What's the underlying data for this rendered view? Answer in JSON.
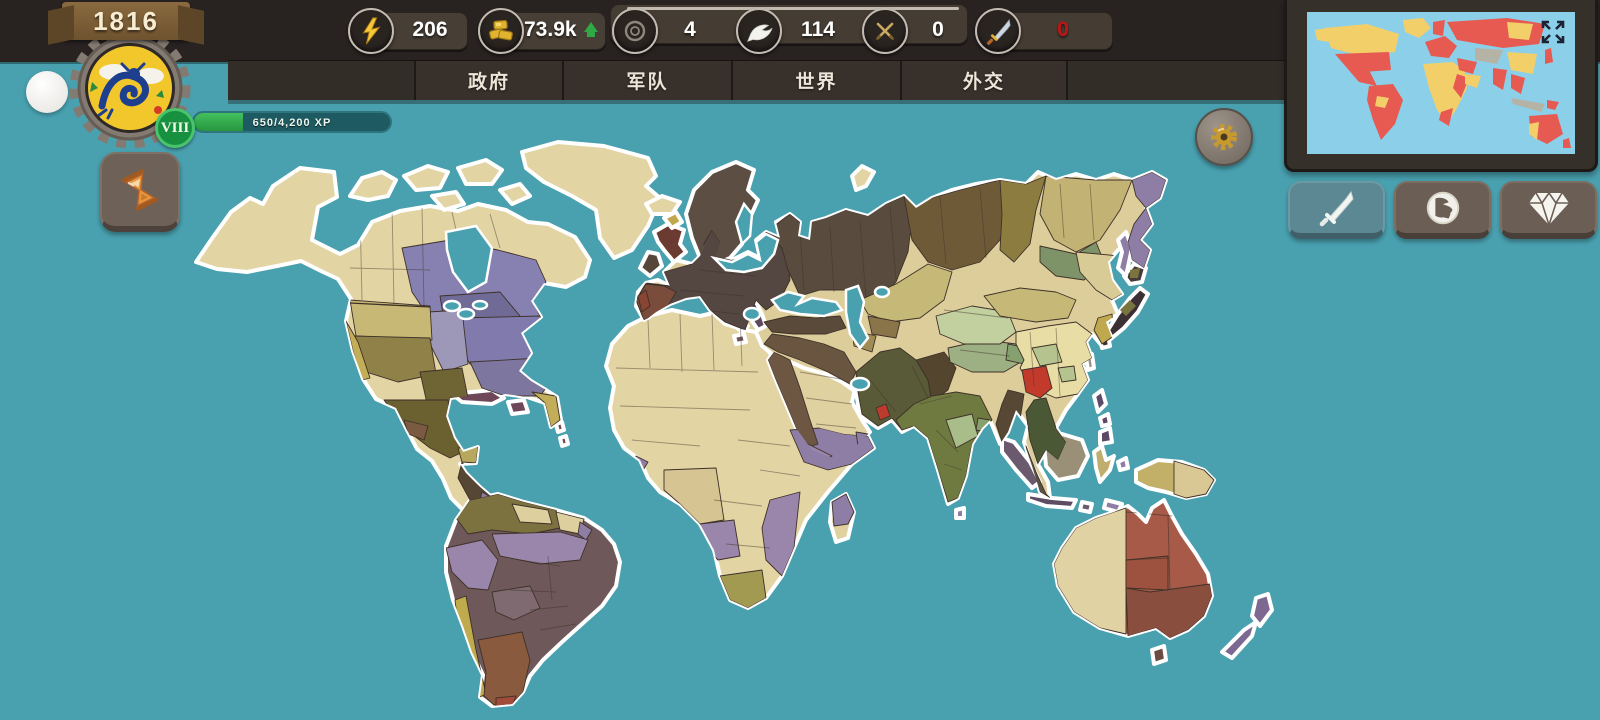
{
  "player": {
    "year": "1816",
    "level": "VIII",
    "xp_text": "650/4,200 XP",
    "flag": "qing-dragon-flag"
  },
  "resources": [
    {
      "id": "energy",
      "icon": "lightning-icon",
      "value": "206"
    },
    {
      "id": "gold",
      "icon": "gold-coins-icon",
      "value": "73.9k",
      "trend": "up"
    },
    {
      "id": "tokens",
      "icon": "ring-coin-icon",
      "value": "4"
    },
    {
      "id": "doves",
      "icon": "dove-icon",
      "value": "114"
    },
    {
      "id": "battles",
      "icon": "crossed-swords-icon",
      "value": "0"
    },
    {
      "id": "wars",
      "icon": "sword-icon",
      "value": "0",
      "alert": true
    }
  ],
  "tabs": [
    {
      "id": "government",
      "label": "政府"
    },
    {
      "id": "army",
      "label": "军队"
    },
    {
      "id": "world",
      "label": "世界"
    },
    {
      "id": "diplomacy",
      "label": "外交"
    }
  ],
  "action_buttons": [
    {
      "id": "war",
      "icon": "sword-icon"
    },
    {
      "id": "world",
      "icon": "globe-icon"
    },
    {
      "id": "premium",
      "icon": "diamond-icon"
    }
  ],
  "colors": {
    "ocean": "#49a1b0",
    "xp_green": "#2fa845",
    "alert_red": "#c01414",
    "minimap_red": "#e65a52",
    "minimap_yellow": "#f3cf6a",
    "minimap_gray": "#b5b3a6"
  }
}
